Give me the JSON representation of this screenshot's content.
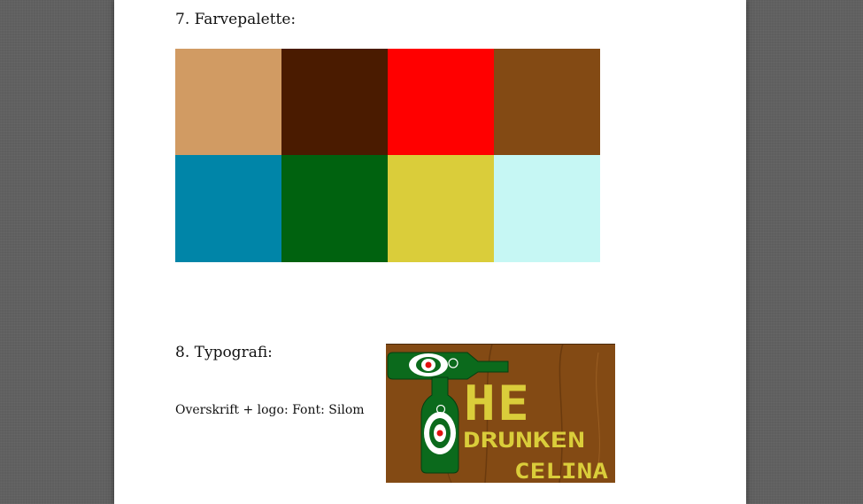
{
  "section7": {
    "heading": "7. Farvepalette:",
    "swatches": [
      "#d19b63",
      "#4a1b00",
      "#ff0000",
      "#834a14",
      "#0085a8",
      "#00620f",
      "#dacd3a",
      "#c6f7f4"
    ]
  },
  "section8": {
    "heading": "8. Typografi:",
    "font_line": "Overskrift + logo: Font: Silom"
  },
  "logo": {
    "line1": "HE",
    "line2": "DRUNKEN",
    "line3": "CELINA",
    "colors": {
      "wood": "#834a14",
      "text": "#dacd3a",
      "bottle": "#0b6a1c",
      "label_red": "#e01010"
    }
  }
}
